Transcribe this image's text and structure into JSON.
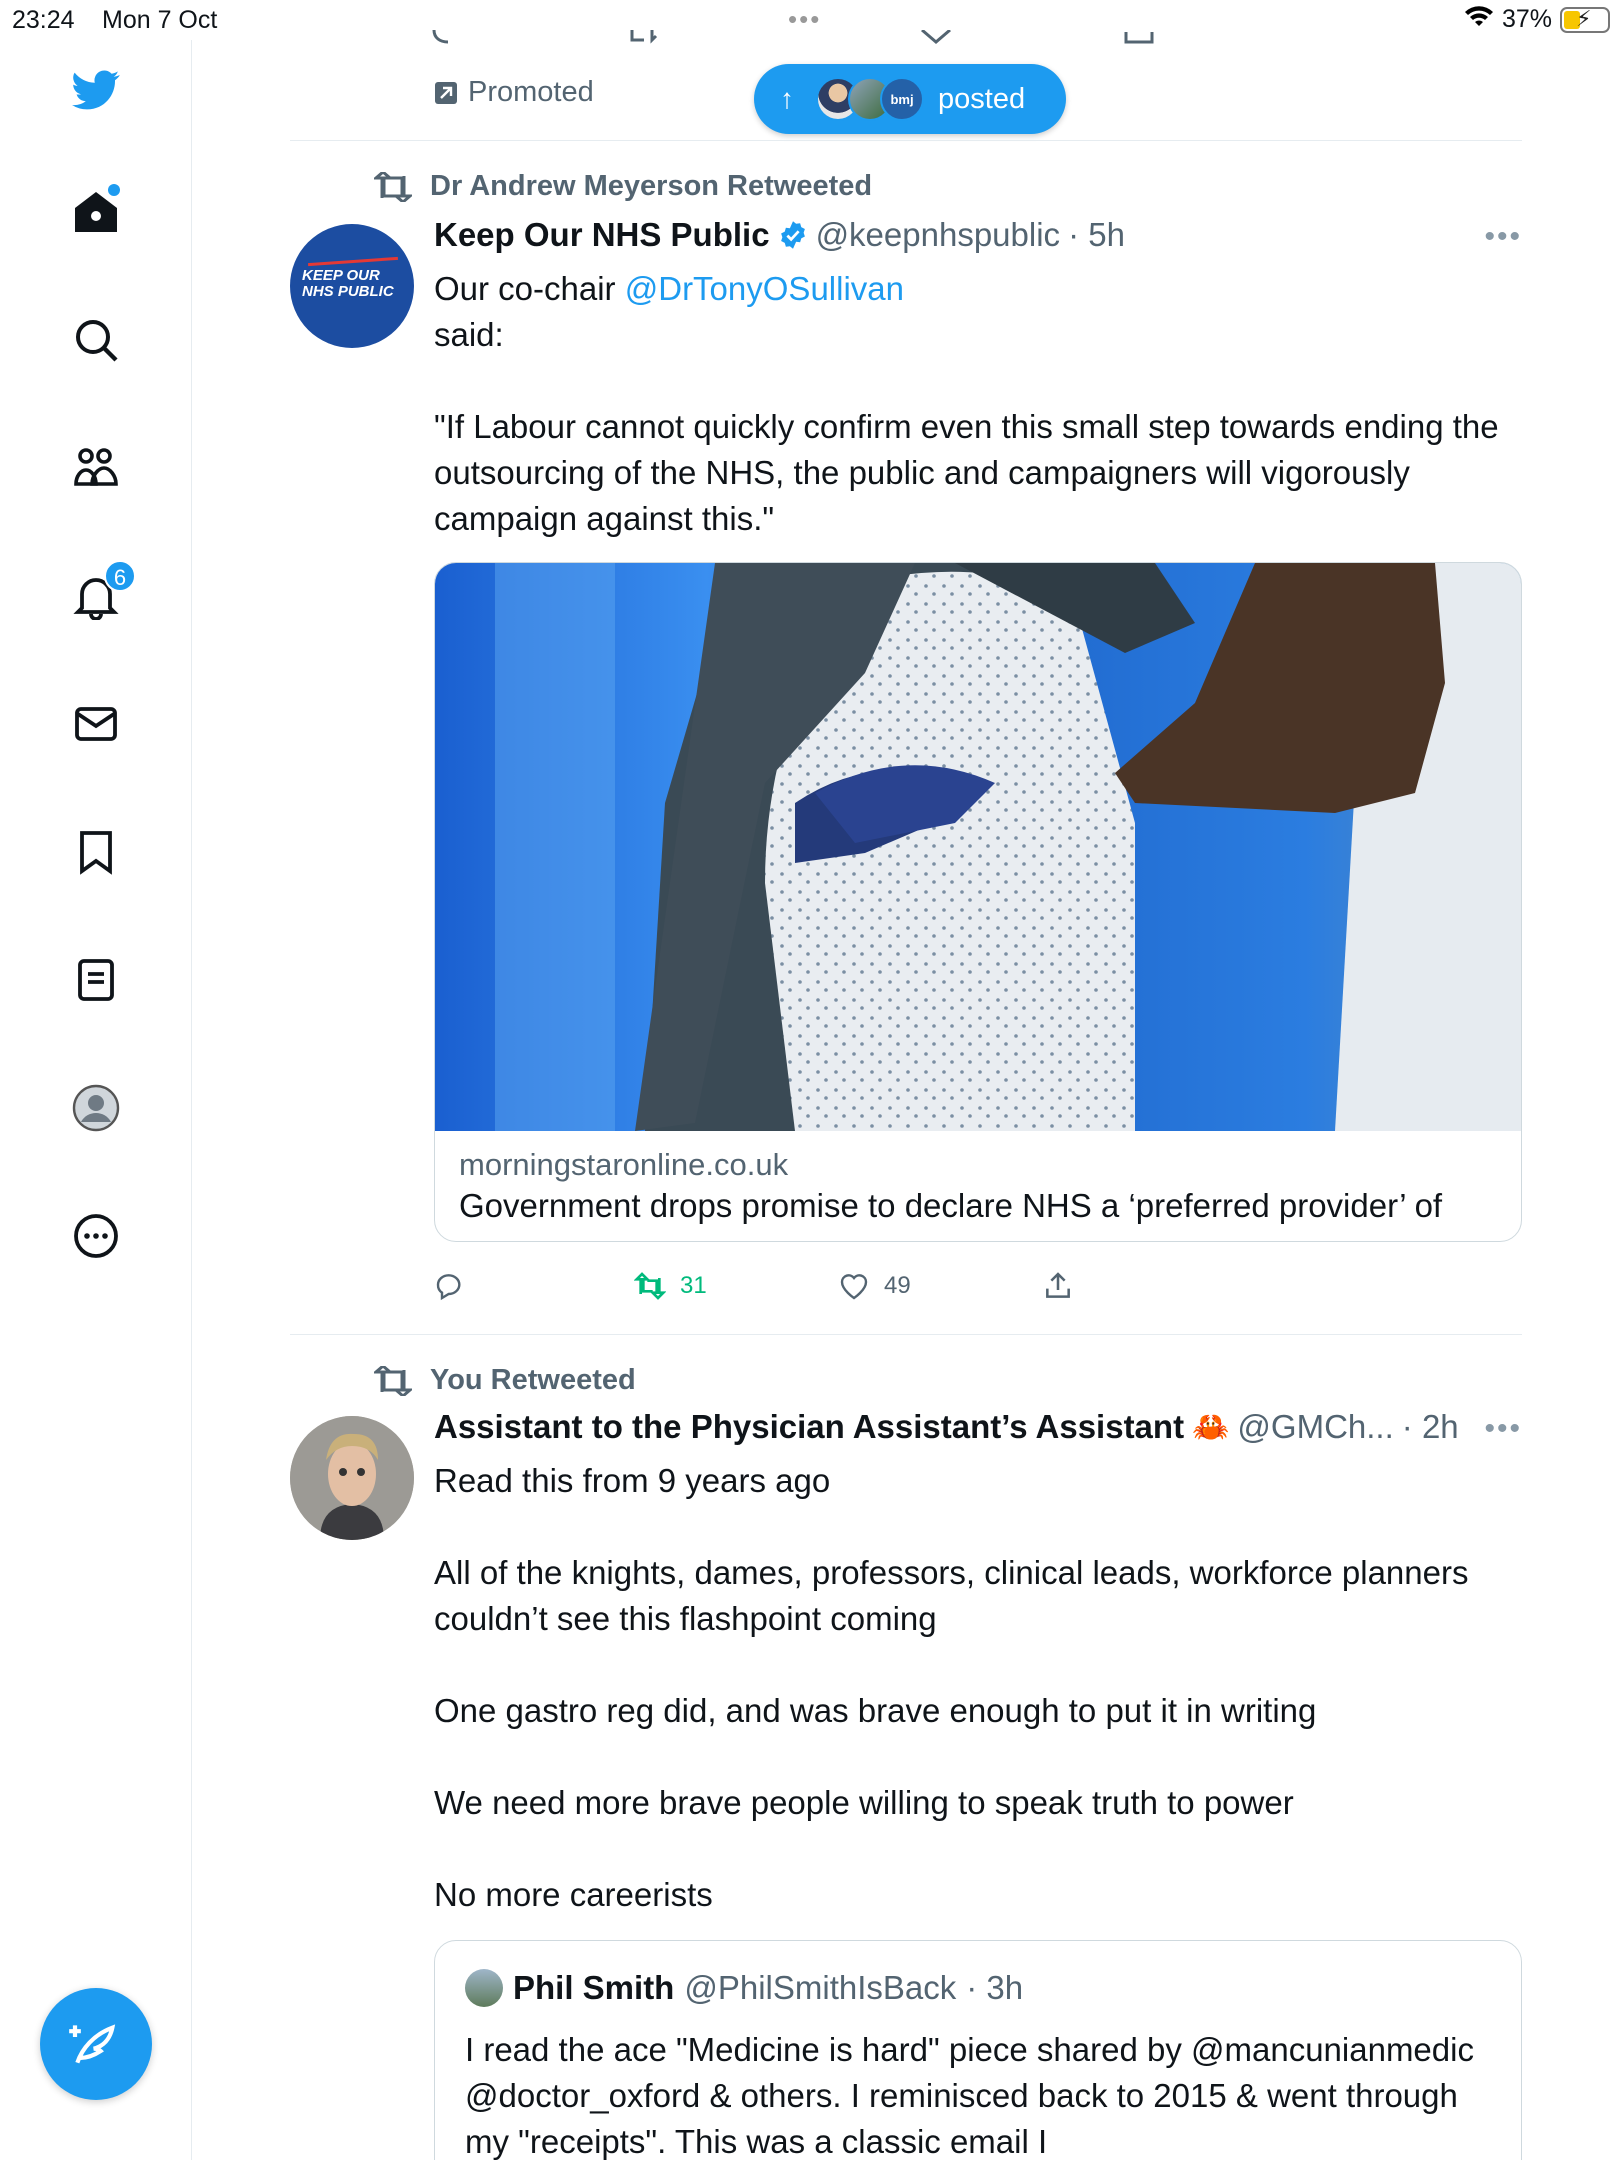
{
  "status_bar": {
    "time": "23:24",
    "date": "Mon 7 Oct",
    "battery": "37%"
  },
  "sidebar": {
    "notifications_count": "6"
  },
  "colors": {
    "accent": "#1d9bf0",
    "retweet_green": "#00ba7c",
    "secondary_text": "#536471"
  },
  "top": {
    "promoted_label": "Promoted",
    "posted_label": "posted",
    "bmj_label": "bmj"
  },
  "tweet1": {
    "retweeted_by": "Dr Andrew Meyerson Retweeted",
    "avatar_text": "KEEP OUR NHS PUBLIC",
    "name": "Keep Our NHS Public",
    "handle": "@keepnhspublic",
    "time": "· 5h",
    "text_prefix": "Our co-chair",
    "mention": "@DrTonyOSullivan",
    "text_said": "said:",
    "quote_text": "\"If Labour cannot quickly confirm even this small step towards ending the outsourcing of the NHS, the public and campaigners will vigorously campaign against this.\"",
    "card_domain": "morningstaronline.co.uk",
    "card_title": "Government drops promise to declare NHS a ‘preferred provider’ of",
    "retweets": "31",
    "likes": "49"
  },
  "tweet2": {
    "retweeted_by": "You Retweeted",
    "name": "Assistant to the Physician Assistant’s Assistant",
    "handle": "@GMCh...",
    "time": "· 2h",
    "lines": [
      "Read this from 9 years ago",
      "All of the knights, dames, professors, clinical leads, workforce planners couldn’t see this flashpoint coming",
      "One gastro reg did, and was brave enough to put it in writing",
      "We need more brave people willing to speak truth to power",
      "No more careerists"
    ],
    "quoted": {
      "name": "Phil Smith",
      "handle": "@PhilSmithIsBack",
      "time": "· 3h",
      "text": "I read the ace \"Medicine is hard\" piece shared by @mancunianmedic @doctor_oxford & others. I reminisced back to 2015 & went through my \"receipts\". This was a classic email I"
    }
  }
}
